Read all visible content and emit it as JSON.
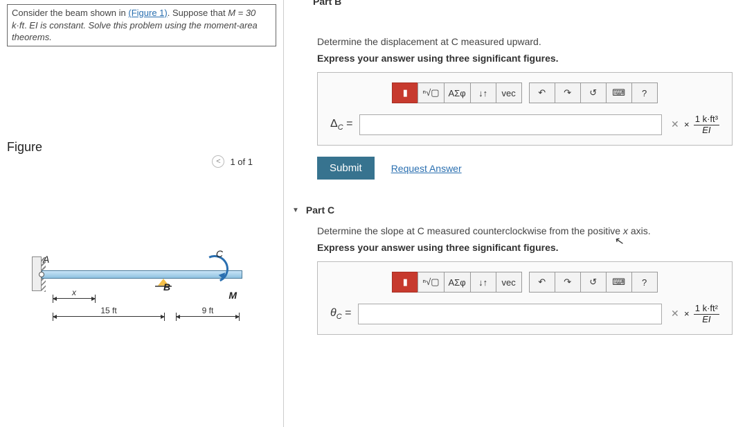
{
  "problem": {
    "text_before_link": "Consider the beam shown in ",
    "figure_link": "(Figure 1)",
    "text_after_link": ". Suppose that ",
    "equation": "M = 30 k·ft",
    "ei_text": "EI is constant. Solve this problem using the moment-area theorems.",
    "punctuation": ". "
  },
  "figure": {
    "label": "Figure",
    "counter": "1 of 1",
    "labels": {
      "a": "A",
      "b": "B",
      "c": "C",
      "m": "M",
      "x": "x"
    },
    "dims": {
      "d15": "15 ft",
      "d9": "9 ft"
    }
  },
  "partB": {
    "header": "Part B",
    "instr1": "Determine the displacement at C measured upward.",
    "instr2": "Express your answer using three significant figures.",
    "var": "Δ",
    "sub": "C",
    "eq": " = ",
    "unit_num": "1 k·ft³",
    "unit_den": "EI"
  },
  "partC": {
    "header": "Part C",
    "instr1_a": "Determine the slope at C measured counterclockwise from the positive ",
    "instr1_var": "x",
    "instr1_b": " axis.",
    "instr2": "Express your answer using three significant figures.",
    "var": "θ",
    "sub": "C",
    "eq": " = ",
    "unit_num": "1 k·ft²",
    "unit_den": "EI"
  },
  "toolbar": {
    "t1": "▮",
    "t2": "ⁿ√▢",
    "t3": "ΑΣφ",
    "t4": "↓↑",
    "t5": "vec",
    "undo": "↶",
    "redo": "↷",
    "reset": "↺",
    "kbd": "⌨",
    "help": "?"
  },
  "buttons": {
    "submit": "Submit",
    "request": "Request Answer"
  }
}
